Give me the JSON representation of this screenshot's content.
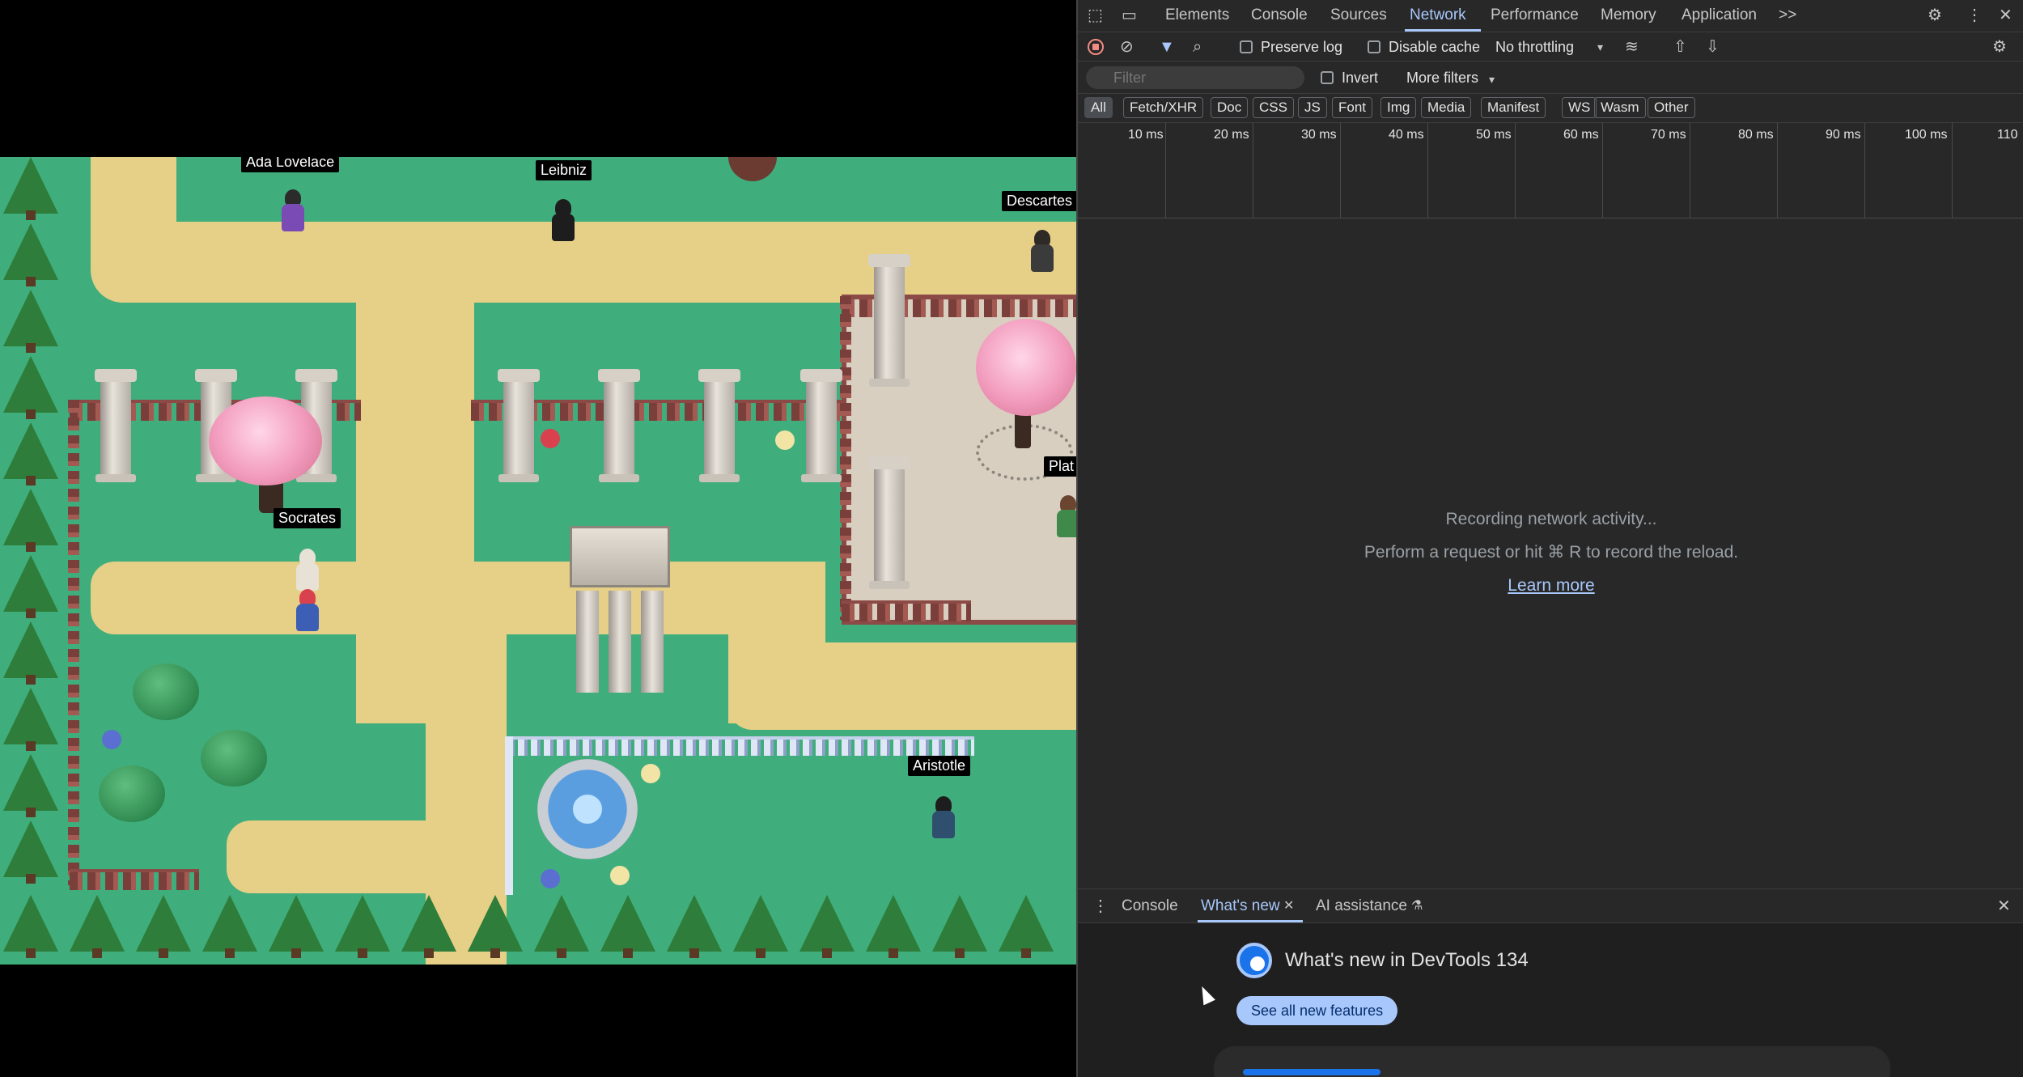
{
  "game": {
    "characters": [
      {
        "name": "Ada Lovelace"
      },
      {
        "name": "Leibniz"
      },
      {
        "name": "Descartes"
      },
      {
        "name": "Socrates"
      },
      {
        "name": "Plat"
      },
      {
        "name": "Aristotle"
      }
    ]
  },
  "devtools": {
    "tabs": [
      "Elements",
      "Console",
      "Sources",
      "Network",
      "Performance",
      "Memory",
      "Application"
    ],
    "active_tab": "Network",
    "more_tabs": ">>",
    "toolbar": {
      "preserve_log": "Preserve log",
      "disable_cache": "Disable cache",
      "throttling": "No throttling"
    },
    "filter": {
      "placeholder": "Filter",
      "invert": "Invert",
      "more_filters": "More filters"
    },
    "type_filters": [
      "All",
      "Fetch/XHR",
      "Doc",
      "CSS",
      "JS",
      "Font",
      "Img",
      "Media",
      "Manifest",
      "WS",
      "Wasm",
      "Other"
    ],
    "timeline_ticks": [
      "10 ms",
      "20 ms",
      "30 ms",
      "40 ms",
      "50 ms",
      "60 ms",
      "70 ms",
      "80 ms",
      "90 ms",
      "100 ms",
      "110"
    ],
    "empty_state": {
      "line1": "Recording network activity...",
      "line2": "Perform a request or hit ⌘ R to record the reload.",
      "learn_more": "Learn more"
    },
    "drawer": {
      "tabs": [
        "Console",
        "What's new",
        "AI assistance"
      ],
      "active_tab": "What's new",
      "title": "What's new in DevTools 134",
      "button": "See all new features"
    }
  },
  "colors": {
    "grass": "#3fae7c",
    "path": "#e6cf86",
    "devtools_bg": "#282828",
    "accent": "#a8c7fa"
  }
}
